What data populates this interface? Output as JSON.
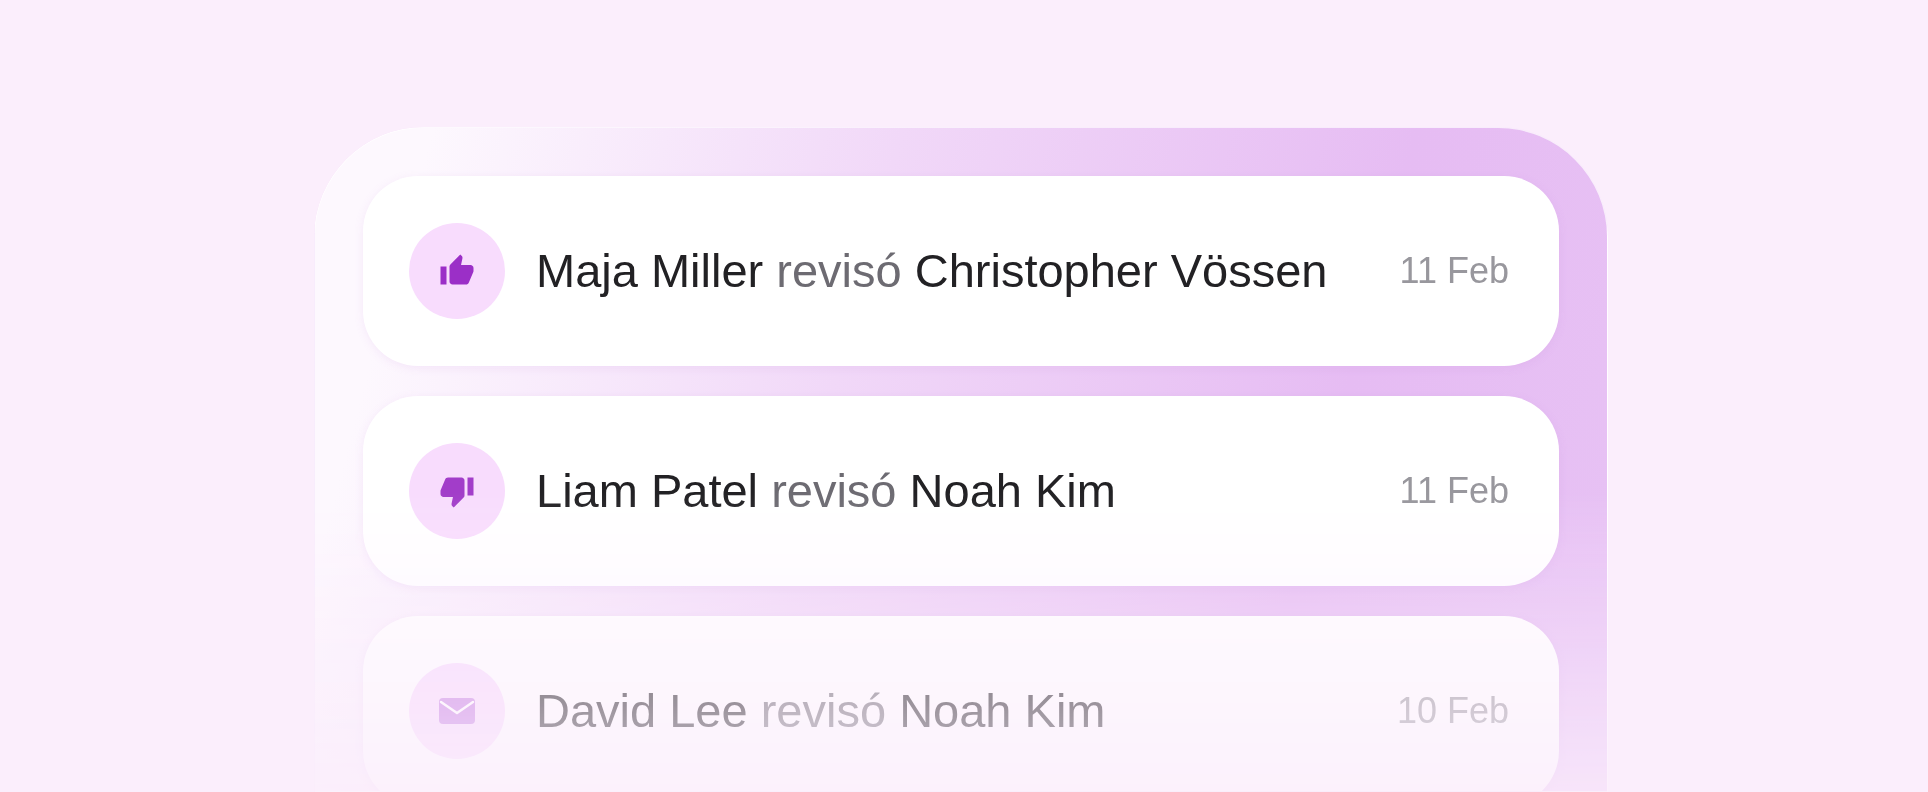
{
  "activity_feed": {
    "items": [
      {
        "kind": "like",
        "actor": "Maja Miller",
        "verb": "revisó",
        "target": "Christopher Vössen",
        "date": "11 Feb"
      },
      {
        "kind": "dislike",
        "actor": "Liam Patel",
        "verb": "revisó",
        "target": "Noah Kim",
        "date": "11 Feb"
      },
      {
        "kind": "message",
        "actor": "David Lee",
        "verb": "revisó",
        "target": "Noah Kim",
        "date": "10 Feb"
      }
    ]
  }
}
